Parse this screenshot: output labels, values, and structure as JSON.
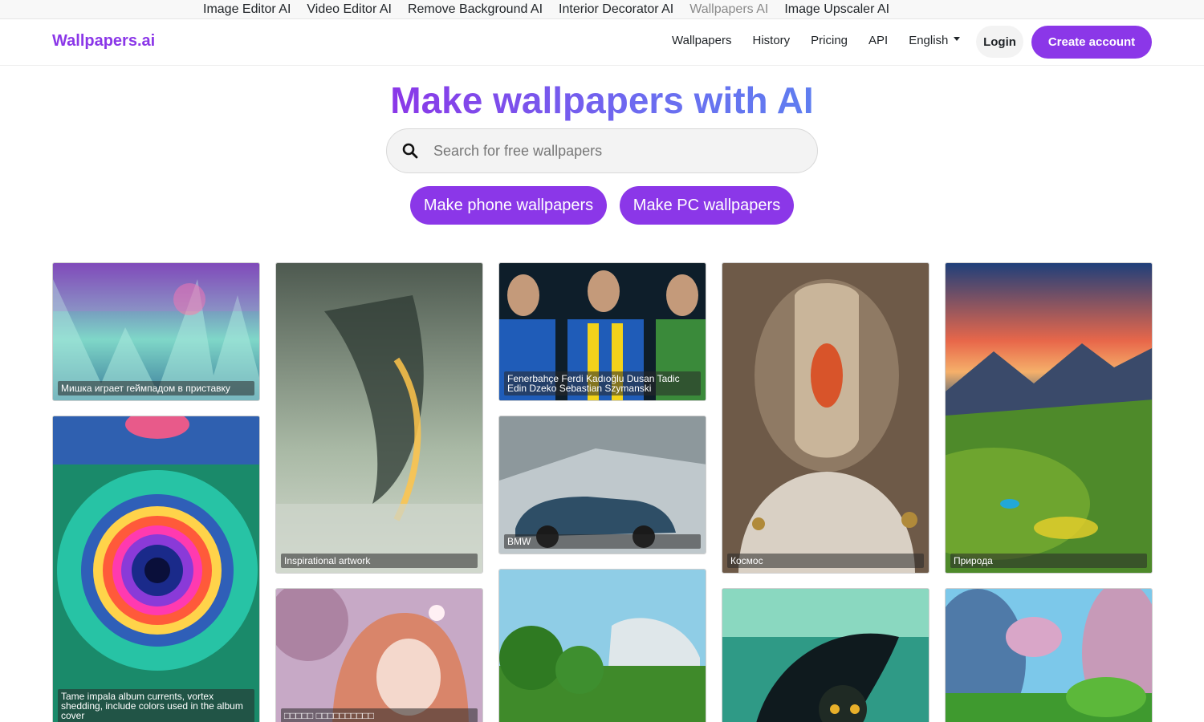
{
  "topbar": {
    "links": [
      "Image Editor AI",
      "Video Editor AI",
      "Remove Background AI",
      "Interior Decorator AI",
      "Wallpapers AI",
      "Image Upscaler AI"
    ]
  },
  "nav": {
    "brand": "Wallpapers.ai",
    "links": [
      "Wallpapers",
      "History",
      "Pricing",
      "API"
    ],
    "language": "English",
    "login": "Login",
    "create_account": "Create account"
  },
  "hero": {
    "title": "Make wallpapers with AI",
    "search_placeholder": "Search for free wallpapers",
    "phone_button": "Make phone wallpapers",
    "pc_button": "Make PC wallpapers"
  },
  "wallpapers": [
    {
      "caption": "Мишка играет геймпадом в приставку"
    },
    {
      "caption": "Tame impala album currents, vortex shedding, include colors used in the album cover"
    },
    {
      "caption": "Inspirational artwork"
    },
    {
      "caption": "□□□□□ □□□□□□□□□□"
    },
    {
      "caption": "Fenerbahçe Ferdi Kadıoğlu Dusan Tadic Edin Dzeko Sebastian Szymanski"
    },
    {
      "caption": "BMW"
    },
    {
      "caption": ""
    },
    {
      "caption": "Космос"
    },
    {
      "caption": ""
    },
    {
      "caption": "Природа"
    },
    {
      "caption": ""
    }
  ],
  "colors": {
    "accent": "#8b37e8",
    "gradient_end": "#5f7ef0"
  },
  "icons": {
    "search": "search-icon",
    "dropdown": "caret-down-icon"
  }
}
